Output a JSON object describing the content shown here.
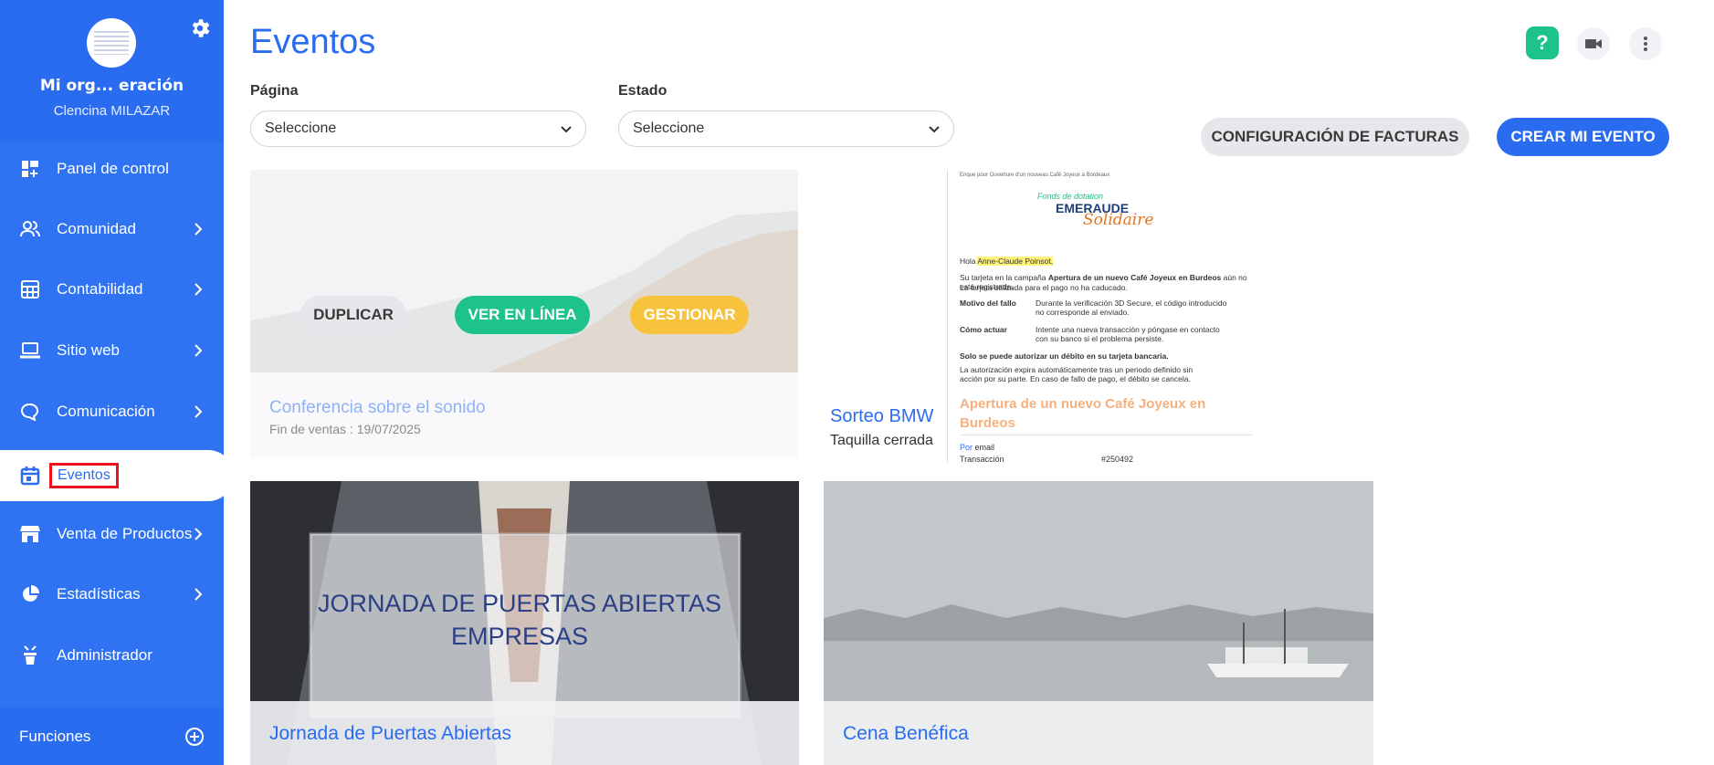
{
  "sidebar": {
    "org_name": "Mi org... eración",
    "org_user": "Clencina MILAZAR",
    "items": [
      {
        "label": "Panel de control",
        "icon": "dashboard-icon",
        "has_chevron": false
      },
      {
        "label": "Comunidad",
        "icon": "community-icon",
        "has_chevron": true
      },
      {
        "label": "Contabilidad",
        "icon": "accounting-icon",
        "has_chevron": true
      },
      {
        "label": "Sitio web",
        "icon": "laptop-icon",
        "has_chevron": true
      },
      {
        "label": "Comunicación",
        "icon": "chat-icon",
        "has_chevron": true
      },
      {
        "label": "Eventos",
        "icon": "calendar-icon",
        "has_chevron": false,
        "active": true
      },
      {
        "label": "Venta de Productos",
        "icon": "shop-icon",
        "has_chevron": true
      },
      {
        "label": "Estadísticas",
        "icon": "pie-chart-icon",
        "has_chevron": true
      },
      {
        "label": "Administrador",
        "icon": "admin-icon",
        "has_chevron": false
      }
    ],
    "functions_label": "Funciones"
  },
  "header": {
    "title": "Eventos",
    "help_label": "?"
  },
  "filters": {
    "page_label": "Página",
    "page_value": "Seleccione",
    "state_label": "Estado",
    "state_value": "Seleccione"
  },
  "actions": {
    "config_label": "CONFIGURACIÓN DE FACTURAS",
    "create_label": "CREAR MI EVENTO"
  },
  "cards": [
    {
      "title": "Conferencia sobre el sonido",
      "subtitle": "Fin de ventas : 19/07/2025",
      "buttons": {
        "duplicate": "DUPLICAR",
        "view": "VER EN LÍNEA",
        "manage": "GESTIONAR"
      }
    },
    {
      "title": "Sorteo BMW",
      "subtitle": "Taquilla cerrada",
      "doc": {
        "header": "Enque pour Ouverture d'un nouveau Café Joyeux à Bordeaux",
        "brand_top": "Fonds de dotation",
        "brand_main": "EMERAUDE",
        "brand_script": "Solidaire",
        "greeting": "Hola ",
        "greeting_name": "Anne-Claude Poinsot,",
        "p1a": "Su tarjeta en la campaña ",
        "p1b": "Apertura de un nuevo Café Joyeux en Burdeos",
        "p1c": " aún no está registrada.",
        "p2": "La tarjeta utilizada para el pago no ha caducado.",
        "row1_k": "Motivo del fallo",
        "row1_v1": "Durante la verificación 3D Secure, el código introducido",
        "row1_v2": "no corresponde al enviado.",
        "row2_k": "Cómo actuar",
        "row2_v1": "Intente una nueva transacción y póngase en contacto",
        "row2_v2": "con su banco si el problema persiste.",
        "p3": "Solo se puede autorizar un débito en su tarjeta bancaria.",
        "p4a": "La autorización expira automáticamente tras un periodo definido sin",
        "p4b": "acción por su parte. En caso de fallo de pago, el débito se cancela.",
        "headline1": "Apertura de un nuevo Café Joyeux en",
        "headline2": "Burdeos",
        "por": "Por",
        "email": " email",
        "trans_k": "Transacción",
        "trans_v": "#250492"
      }
    },
    {
      "title": "Jornada de Puertas Abiertas",
      "image_text_1": "JORNADA DE PUERTAS ABIERTAS",
      "image_text_2": "EMPRESAS"
    },
    {
      "title": "Cena Benéfica"
    }
  ],
  "colors": {
    "primary": "#2a6cf0",
    "sidebar": "#2f73f2",
    "green": "#1ec28b",
    "yellow": "#f7c33c",
    "highlight": "#e8131c"
  }
}
